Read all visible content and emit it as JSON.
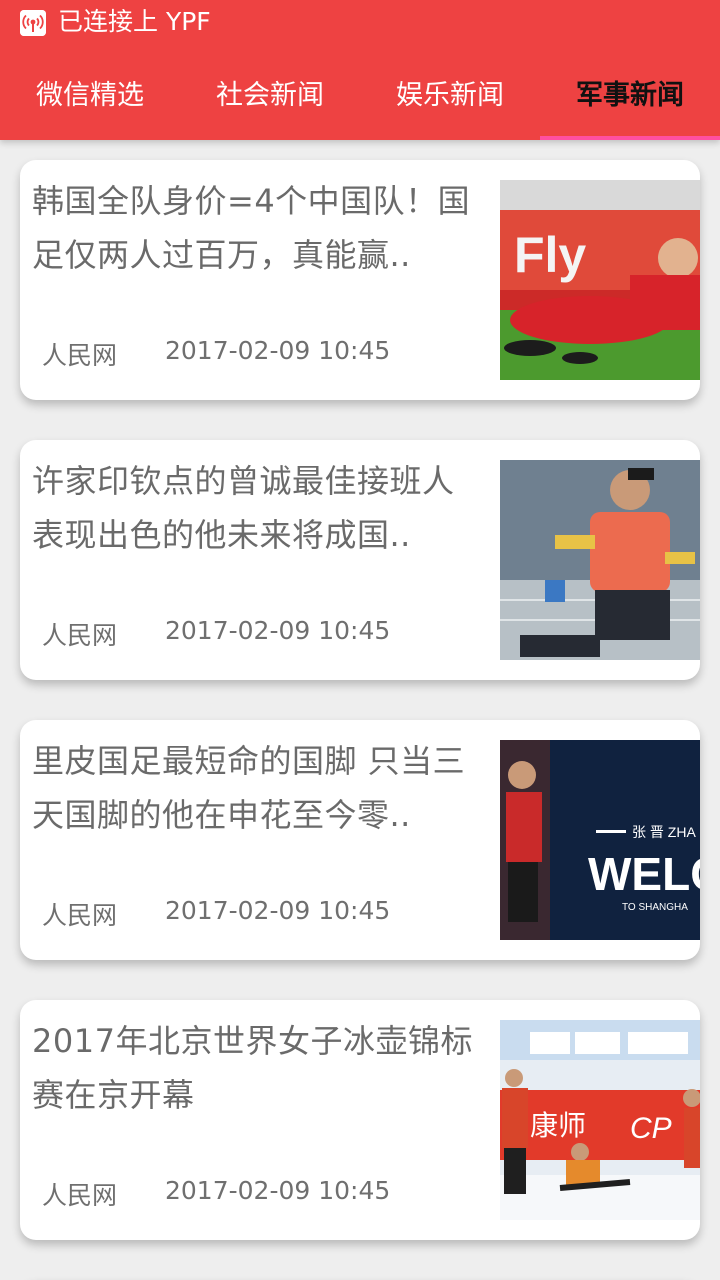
{
  "status_bar": {
    "text": "已连接上 YPF",
    "icon": "wifi-hotspot-icon"
  },
  "tabs": [
    {
      "label": "微信精选",
      "active": false
    },
    {
      "label": "社会新闻",
      "active": false
    },
    {
      "label": "娱乐新闻",
      "active": false
    },
    {
      "label": "军事新闻",
      "active": true
    }
  ],
  "colors": {
    "header": "#ee4242",
    "tab_indicator": "#ff4fa0",
    "card_background": "#ffffff",
    "page_background": "#eeeeee"
  },
  "articles": [
    {
      "title": "韩国全队身价=4个中国队！国足仅两人过百万，真能赢..",
      "source": "人民网",
      "date": "2017-02-09 10:45",
      "thumbnail": "football-players-red-jersey-photo"
    },
    {
      "title": "许家印钦点的曾诚最佳接班人 表现出色的他未来将成国..",
      "source": "人民网",
      "date": "2017-02-09 10:45",
      "thumbnail": "goalkeeper-kicking-photo"
    },
    {
      "title": "里皮国足最短命的国脚 只当三天国脚的他在申花至今零..",
      "source": "人民网",
      "date": "2017-02-09 10:45",
      "thumbnail": "player-welcome-board-photo"
    },
    {
      "title": "2017年北京世界女子冰壶锦标赛在京开幕",
      "source": "人民网",
      "date": "2017-02-09 10:45",
      "thumbnail": "curling-match-photo"
    }
  ]
}
